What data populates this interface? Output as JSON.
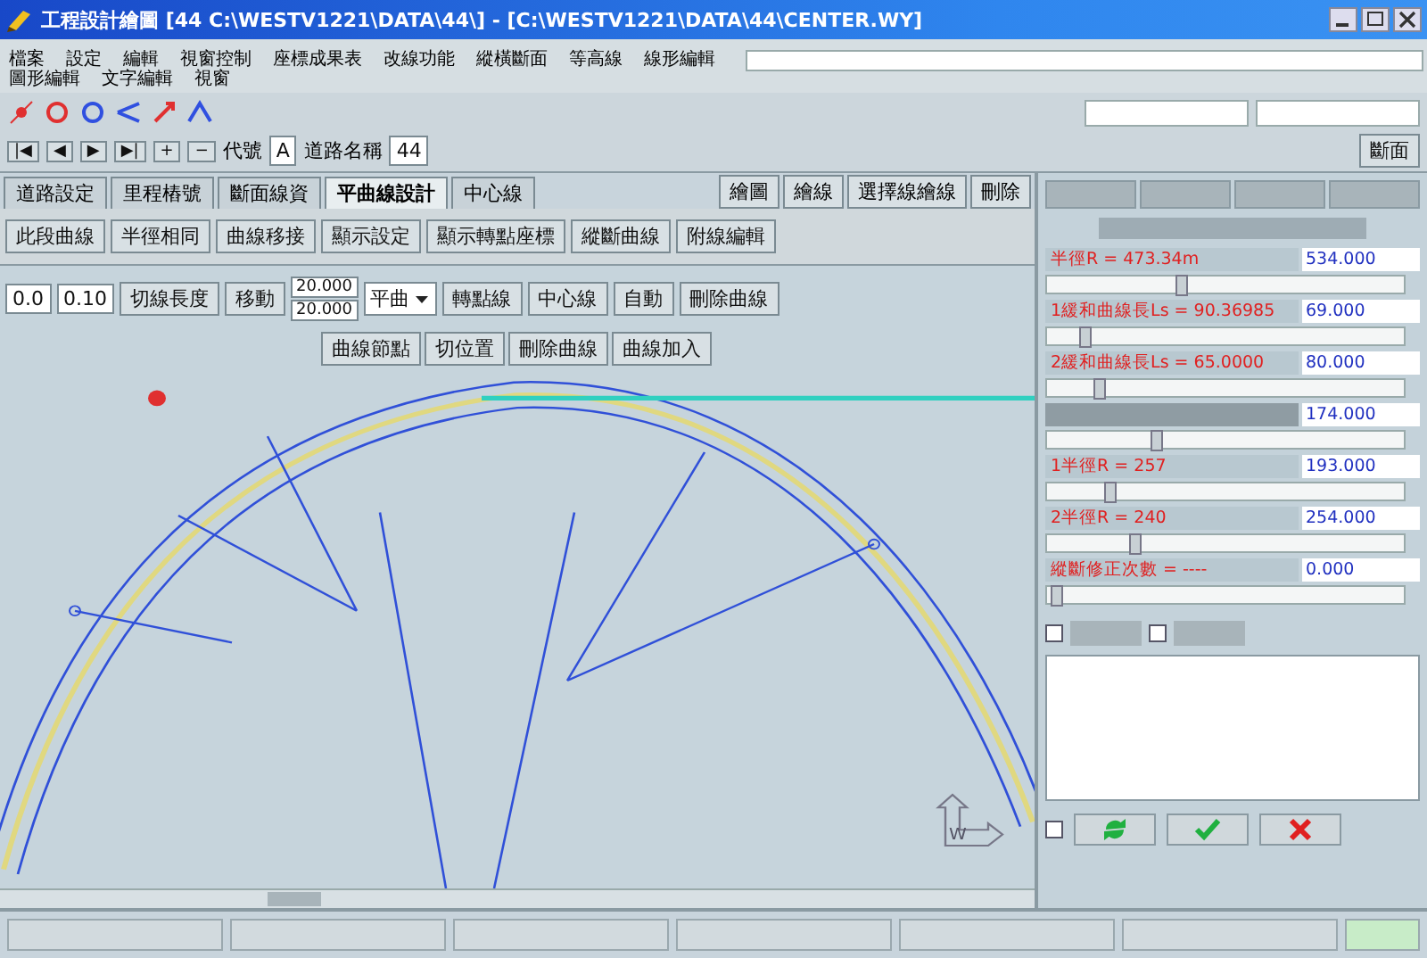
{
  "window": {
    "title": "工程設計繪圖 [44 C:\\WESTV1221\\DATA\\44\\] - [C:\\WESTV1221\\DATA\\44\\CENTER.WY]"
  },
  "menu": {
    "main": [
      "檔案",
      "設定",
      "編輯",
      "視窗控制",
      "座標成果表",
      "改線功能",
      "縱橫斷面",
      "等高線",
      "線形編輯"
    ],
    "second": [
      "圖形編輯",
      "文字編輯",
      "視窗"
    ]
  },
  "toolbar": {
    "nav_buttons": [
      "|◀",
      "◀",
      "▶",
      "▶|",
      "+",
      "−"
    ],
    "code_label": "代號",
    "code_value": "A",
    "road_label": "道路名稱",
    "road_value": "44",
    "section_button": "斷面"
  },
  "tabs": [
    {
      "label": "道路設定",
      "selected": false
    },
    {
      "label": "里程樁號",
      "selected": false
    },
    {
      "label": "斷面線資",
      "selected": false
    },
    {
      "label": "平曲線設計",
      "selected": true
    },
    {
      "label": "中心線",
      "selected": false
    }
  ],
  "view_tabs": [
    "繪圖",
    "繪線",
    "選擇線繪線",
    "刪除"
  ],
  "curve_buttons": [
    "此段曲線",
    "半徑相同",
    "曲線移接",
    "顯示設定",
    "顯示轉點座標",
    "縱斷曲線",
    "附線編輯"
  ],
  "edit_row": {
    "start": "0.0",
    "step": "0.10",
    "tangent_button": "切線長度",
    "move_button": "移動",
    "value_1": "20.000",
    "value_2": "20.000",
    "mode": "平曲",
    "buttons": [
      "轉點線",
      "中心線",
      "自動",
      "刪除曲線"
    ]
  },
  "node_buttons": [
    "曲線節點",
    "切位置",
    "刪除曲線",
    "曲線加入"
  ],
  "canvas": {
    "compass_label": "W"
  },
  "panel": {
    "rows": [
      {
        "label": "半徑R = 473.34m",
        "value": "534.000",
        "level": 0.37
      },
      {
        "label": "1緩和曲線長Ls = 90.36985",
        "value": "69.000",
        "level": 0.1
      },
      {
        "label": "2緩和曲線長Ls = 65.0000",
        "value": "80.000",
        "level": 0.14
      },
      {
        "value": "174.000",
        "level": 0.3
      },
      {
        "label": "1半徑R = 257",
        "value": "193.000",
        "level": 0.17
      },
      {
        "label": "2半徑R = 240",
        "value": "254.000",
        "level": 0.24
      },
      {
        "label": "縱斷修正次數 = ----",
        "value": "0.000",
        "level": 0.02
      }
    ],
    "options": [
      {
        "checked": false
      },
      {
        "checked": false
      }
    ],
    "bottom_checkbox": {
      "checked": false
    },
    "bottom_buttons": [
      {
        "kind": "refresh"
      },
      {
        "kind": "ok"
      },
      {
        "kind": "cancel"
      }
    ]
  }
}
